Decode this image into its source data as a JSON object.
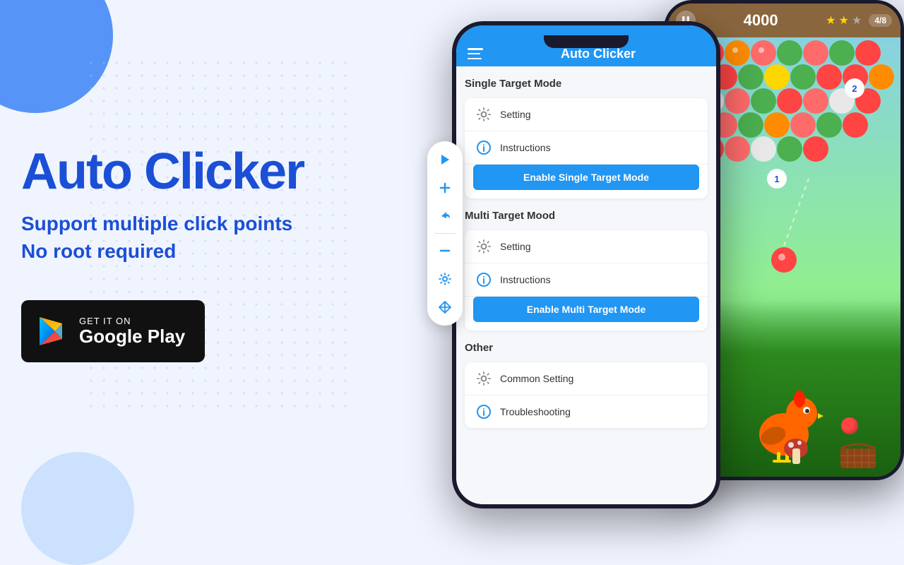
{
  "app": {
    "title": "Auto Clicker",
    "tagline_1": "Support multiple click points",
    "tagline_2": "No root required"
  },
  "left_panel": {
    "app_name": "Auto Clicker",
    "subtitle_1": "Support multiple click points",
    "subtitle_2": "No root required",
    "badge": {
      "get_it_on": "GET IT ON",
      "store_name": "Google Play"
    }
  },
  "phone_app": {
    "appbar_title": "Auto Clicker",
    "sections": [
      {
        "id": "single",
        "title": "Single Target Mode",
        "items": [
          "Setting",
          "Instructions"
        ],
        "button": "Enable Single Target Mode"
      },
      {
        "id": "multi",
        "title": "Multi Target Mood",
        "items": [
          "Setting",
          "Instructions"
        ],
        "button": "Enable Multi Target Mode"
      },
      {
        "id": "other",
        "title": "Other",
        "items": [
          "Common Setting",
          "Troubleshooting"
        ],
        "button": null
      }
    ]
  },
  "game_phone": {
    "score": "4000",
    "level": "4/8",
    "stars": [
      true,
      true,
      false
    ]
  },
  "icons": {
    "play": "▶",
    "plus": "+",
    "share": "↗",
    "minus": "−",
    "gear": "⚙",
    "move": "✥",
    "info": "ℹ",
    "pause": "⏸"
  }
}
